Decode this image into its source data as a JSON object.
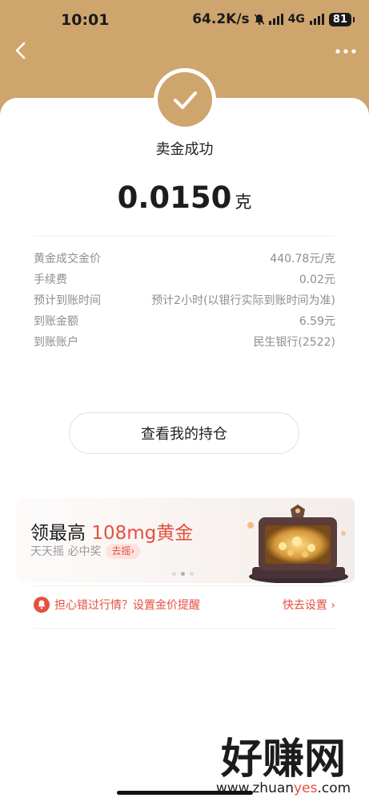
{
  "status": {
    "time": "10:01",
    "speed": "64.2K/s",
    "network": "4G",
    "battery": "81"
  },
  "nav": {
    "back_icon": "chevron-left-icon",
    "more_icon": "more-dots-icon"
  },
  "result": {
    "title": "卖金成功",
    "amount": "0.0150",
    "unit": "克"
  },
  "details": [
    {
      "label": "黄金成交金价",
      "value": "440.78元/克"
    },
    {
      "label": "手续费",
      "value": "0.02元"
    },
    {
      "label": "预计到账时间",
      "value": "预计2小时(以银行实际到账时间为准)"
    },
    {
      "label": "到账金额",
      "value": "6.59元"
    },
    {
      "label": "到账账户",
      "value": "民生银行(2522)"
    }
  ],
  "button": {
    "label": "查看我的持仓"
  },
  "banner": {
    "title_prefix": "领最高 ",
    "title_highlight": "108mg黄金",
    "subtitle": "天天摇 必中奖",
    "cta": "去摇",
    "cta_arrow": "›",
    "active_dot": 1
  },
  "reminder": {
    "text": "担心错过行情？设置金价提醒",
    "action": "快去设置",
    "arrow": "›"
  },
  "watermark": {
    "main": "好赚网",
    "sub_a": "www.zhuan",
    "sub_b": "yes",
    "sub_c": ".com"
  },
  "colors": {
    "gold": "#cfa56e",
    "accent_red": "#e4503f"
  }
}
